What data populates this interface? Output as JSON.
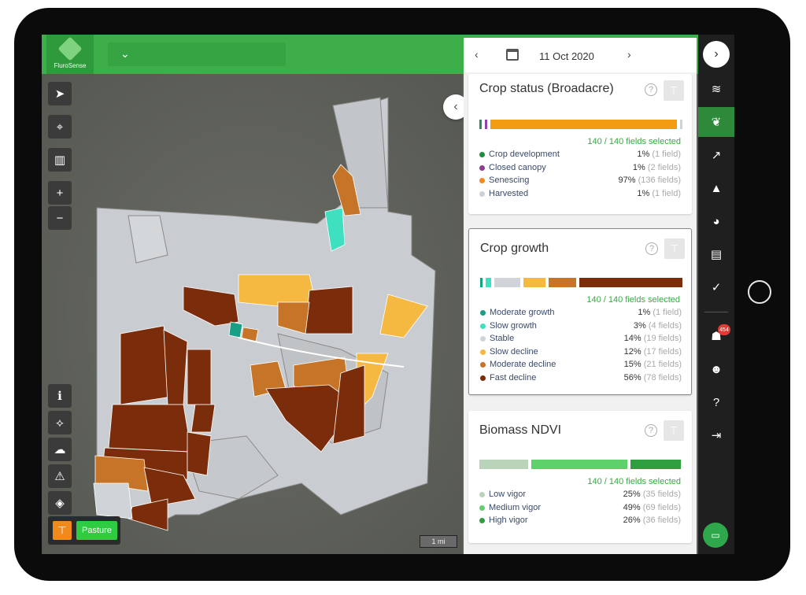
{
  "app": {
    "name": "FluroSense",
    "field_selector_icon": "chevron-down-icon"
  },
  "date_nav": {
    "prev_icon": "chevron-left-icon",
    "calendar_icon": "calendar-icon",
    "date": "11 Oct 2020",
    "next_icon": "chevron-right-icon"
  },
  "map_tools": [
    {
      "name": "navigate-icon",
      "glyph": "➤"
    },
    {
      "name": "locate-icon",
      "glyph": "⌖"
    },
    {
      "name": "ruler-icon",
      "glyph": "▥"
    },
    {
      "name": "zoom-in-icon",
      "glyph": "+"
    },
    {
      "name": "zoom-out-icon",
      "glyph": "−"
    }
  ],
  "map_tools_bottom": [
    {
      "name": "info-icon",
      "glyph": "ℹ"
    },
    {
      "name": "draw-polygon-icon",
      "glyph": "⟡"
    },
    {
      "name": "weather-icon",
      "glyph": "☁"
    },
    {
      "name": "warning-icon",
      "glyph": "⚠"
    },
    {
      "name": "layers-icon",
      "glyph": "◈"
    }
  ],
  "pasture": {
    "label": "Pasture",
    "icon": "filter-icon"
  },
  "scale": {
    "label": "1 mi"
  },
  "cards": {
    "crop_status": {
      "title": "Crop status (Broadacre)",
      "selected": "140 / 140 fields selected",
      "bar": [
        {
          "color": "#2e8b57",
          "pct": 1
        },
        {
          "color": "#8e44ad",
          "pct": 1
        },
        {
          "color": "#f39c12",
          "pct": 97
        },
        {
          "color": "#d0d3d4",
          "pct": 1
        }
      ],
      "items": [
        {
          "label": "Crop development",
          "pct": "1%",
          "count": "(1 field)",
          "color": "#1e8e3e"
        },
        {
          "label": "Closed canopy",
          "pct": "1%",
          "count": "(2 fields)",
          "color": "#8e3c96"
        },
        {
          "label": "Senescing",
          "pct": "97%",
          "count": "(136 fields)",
          "color": "#f28b1e"
        },
        {
          "label": "Harvested",
          "pct": "1%",
          "count": "(1 field)",
          "color": "#ccd2d6"
        }
      ]
    },
    "crop_growth": {
      "title": "Crop growth",
      "selected": "140 / 140 fields selected",
      "bar": [
        {
          "color": "#1a9e86",
          "pct": 1
        },
        {
          "color": "#3ee0c0",
          "pct": 3
        },
        {
          "color": "#d0d4d8",
          "pct": 14
        },
        {
          "color": "#f5b841",
          "pct": 12
        },
        {
          "color": "#c67528",
          "pct": 15
        },
        {
          "color": "#7b2d0b",
          "pct": 56
        }
      ],
      "items": [
        {
          "label": "Moderate growth",
          "pct": "1%",
          "count": "(1 field)",
          "color": "#1a9e86"
        },
        {
          "label": "Slow growth",
          "pct": "3%",
          "count": "(4 fields)",
          "color": "#3ee0c0"
        },
        {
          "label": "Stable",
          "pct": "14%",
          "count": "(19 fields)",
          "color": "#cfd4d8"
        },
        {
          "label": "Slow decline",
          "pct": "12%",
          "count": "(17 fields)",
          "color": "#f5b841"
        },
        {
          "label": "Moderate decline",
          "pct": "15%",
          "count": "(21 fields)",
          "color": "#c67528"
        },
        {
          "label": "Fast decline",
          "pct": "56%",
          "count": "(78 fields)",
          "color": "#7b2d0b"
        }
      ]
    },
    "biomass": {
      "title": "Biomass NDVI",
      "selected": "140 / 140 fields selected",
      "bar": [
        {
          "color": "#b9d4b9",
          "pct": 25
        },
        {
          "color": "#5fd16b",
          "pct": 49
        },
        {
          "color": "#2e9e3e",
          "pct": 26
        }
      ],
      "items": [
        {
          "label": "Low vigor",
          "pct": "25%",
          "count": "(35 fields)",
          "color": "#b9d4b9"
        },
        {
          "label": "Medium vigor",
          "pct": "49%",
          "count": "(69 fields)",
          "color": "#5fd16b"
        },
        {
          "label": "High vigor",
          "pct": "26%",
          "count": "(36 fields)",
          "color": "#2e9e3e"
        }
      ]
    }
  },
  "right_rail": {
    "expand_icon": "chevron-right-icon",
    "items": [
      {
        "name": "fields-layers-icon",
        "glyph": "≋"
      },
      {
        "name": "crop-icon",
        "glyph": "❦",
        "active": true
      },
      {
        "name": "analytics-icon",
        "glyph": "↗"
      },
      {
        "name": "alerts-icon",
        "glyph": "▲"
      },
      {
        "name": "zoning-icon",
        "glyph": "◕"
      },
      {
        "name": "imagery-icon",
        "glyph": "▤"
      },
      {
        "name": "reports-icon",
        "glyph": "✓"
      }
    ],
    "items_bottom": [
      {
        "name": "team-icon",
        "glyph": "☗",
        "badge": "454"
      },
      {
        "name": "profile-icon",
        "glyph": "☻"
      },
      {
        "name": "help-icon",
        "glyph": "?"
      },
      {
        "name": "logout-icon",
        "glyph": "⇥"
      }
    ],
    "chat_icon": "chat-icon"
  },
  "colors": {
    "brand_green": "#3dae4a",
    "rail": "#1f1f1f"
  }
}
